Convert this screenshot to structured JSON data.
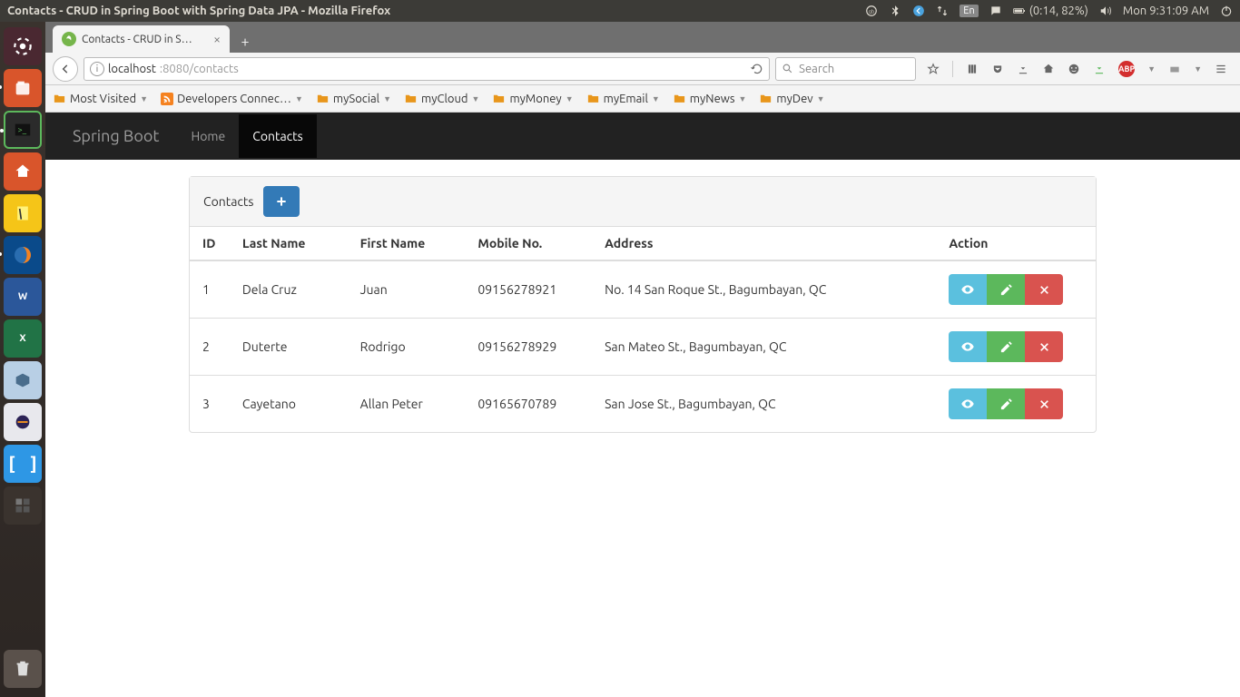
{
  "os": {
    "window_title": "Contacts - CRUD in Spring Boot with Spring Data JPA - Mozilla Firefox",
    "battery": "(0:14, 82%)",
    "clock": "Mon  9:31:09 AM",
    "lang": "En"
  },
  "browser": {
    "tab_title": "Contacts - CRUD in S…",
    "url_host": "localhost",
    "url_rest": ":8080/contacts",
    "search_placeholder": "Search"
  },
  "bookmarks": [
    {
      "label": "Most Visited",
      "kind": "folder"
    },
    {
      "label": "Developers Connec…",
      "kind": "rss"
    },
    {
      "label": "mySocial",
      "kind": "folder"
    },
    {
      "label": "myCloud",
      "kind": "folder"
    },
    {
      "label": "myMoney",
      "kind": "folder"
    },
    {
      "label": "myEmail",
      "kind": "folder"
    },
    {
      "label": "myNews",
      "kind": "folder"
    },
    {
      "label": "myDev",
      "kind": "folder"
    }
  ],
  "app": {
    "brand": "Spring Boot",
    "nav": {
      "home": "Home",
      "contacts": "Contacts"
    },
    "panel_title": "Contacts",
    "columns": {
      "id": "ID",
      "last": "Last Name",
      "first": "First Name",
      "mobile": "Mobile No.",
      "address": "Address",
      "action": "Action"
    },
    "rows": [
      {
        "id": "1",
        "last": "Dela Cruz",
        "first": "Juan",
        "mobile": "09156278921",
        "address": "No. 14 San Roque St., Bagumbayan, QC"
      },
      {
        "id": "2",
        "last": "Duterte",
        "first": "Rodrigo",
        "mobile": "09156278929",
        "address": "San Mateo St., Bagumbayan, QC"
      },
      {
        "id": "3",
        "last": "Cayetano",
        "first": "Allan Peter",
        "mobile": "09165670789",
        "address": "San Jose St., Bagumbayan, QC"
      }
    ]
  }
}
